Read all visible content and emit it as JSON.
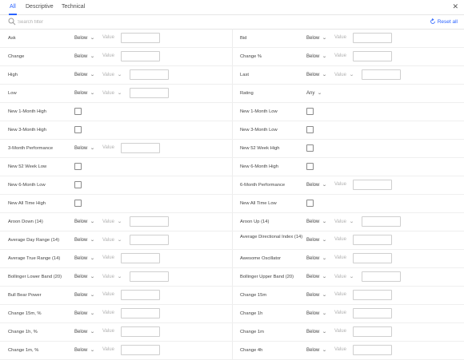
{
  "tabs": [
    "All",
    "Descriptive",
    "Technical"
  ],
  "active_tab": "All",
  "accent_color": "#2962ff",
  "search": {
    "placeholder": "Search filter",
    "value": ""
  },
  "reset_label": "Reset all",
  "rows": [
    [
      {
        "label": "Ask",
        "type": "value",
        "op": "Below",
        "value_label": "Value"
      },
      {
        "label": "Bid",
        "type": "value",
        "op": "Below",
        "value_label": "Value"
      }
    ],
    [
      {
        "label": "Change",
        "type": "value",
        "op": "Below",
        "value_label": "Value"
      },
      {
        "label": "Change %",
        "type": "value",
        "op": "Below",
        "value_label": "Value"
      }
    ],
    [
      {
        "label": "High",
        "type": "select",
        "op": "Below",
        "value_label": "Value"
      },
      {
        "label": "Last",
        "type": "select",
        "op": "Below",
        "value_label": "Value"
      }
    ],
    [
      {
        "label": "Low",
        "type": "select",
        "op": "Below",
        "value_label": "Value"
      },
      {
        "label": "Rating",
        "type": "rating",
        "op": "Any"
      }
    ],
    [
      {
        "label": "New 1-Month High",
        "type": "check"
      },
      {
        "label": "New 1-Month Low",
        "type": "check"
      }
    ],
    [
      {
        "label": "New 3-Month High",
        "type": "check"
      },
      {
        "label": "New 3-Month Low",
        "type": "check"
      }
    ],
    [
      {
        "label": "3-Month Performance",
        "type": "value",
        "op": "Below",
        "value_label": "Value"
      },
      {
        "label": "New 52 Week High",
        "type": "check"
      }
    ],
    [
      {
        "label": "New 52 Week Low",
        "type": "check"
      },
      {
        "label": "New 6-Month High",
        "type": "check"
      }
    ],
    [
      {
        "label": "New 6-Month Low",
        "type": "check"
      },
      {
        "label": "6-Month Performance",
        "type": "value",
        "op": "Below",
        "value_label": "Value"
      }
    ],
    [
      {
        "label": "New All Time High",
        "type": "check"
      },
      {
        "label": "New All Time Low",
        "type": "check"
      }
    ],
    [
      {
        "label": "Aroon Down (14)",
        "type": "select",
        "op": "Below",
        "value_label": "Value"
      },
      {
        "label": "Aroon Up (14)",
        "type": "select",
        "op": "Below",
        "value_label": "Value"
      }
    ],
    [
      {
        "label": "Average Day Range (14)",
        "type": "select",
        "op": "Below",
        "value_label": "Value"
      },
      {
        "label": "Average Directional Index (14)",
        "type": "value",
        "op": "Below",
        "value_label": "Value"
      }
    ],
    [
      {
        "label": "Average True Range (14)",
        "type": "value",
        "op": "Below",
        "value_label": "Value"
      },
      {
        "label": "Awesome Oscillator",
        "type": "value",
        "op": "Below",
        "value_label": "Value"
      }
    ],
    [
      {
        "label": "Bollinger Lower Band (20)",
        "type": "select",
        "op": "Below",
        "value_label": "Value"
      },
      {
        "label": "Bollinger Upper Band (20)",
        "type": "select",
        "op": "Below",
        "value_label": "Value"
      }
    ],
    [
      {
        "label": "Bull Bear Power",
        "type": "value",
        "op": "Below",
        "value_label": "Value"
      },
      {
        "label": "Change 15m",
        "type": "value",
        "op": "Below",
        "value_label": "Value"
      }
    ],
    [
      {
        "label": "Change 15m, %",
        "type": "value",
        "op": "Below",
        "value_label": "Value"
      },
      {
        "label": "Change 1h",
        "type": "value",
        "op": "Below",
        "value_label": "Value"
      }
    ],
    [
      {
        "label": "Change 1h, %",
        "type": "value",
        "op": "Below",
        "value_label": "Value"
      },
      {
        "label": "Change 1m",
        "type": "value",
        "op": "Below",
        "value_label": "Value"
      }
    ],
    [
      {
        "label": "Change 1m, %",
        "type": "value",
        "op": "Below",
        "value_label": "Value"
      },
      {
        "label": "Change 4h",
        "type": "value",
        "op": "Below",
        "value_label": "Value"
      }
    ]
  ]
}
